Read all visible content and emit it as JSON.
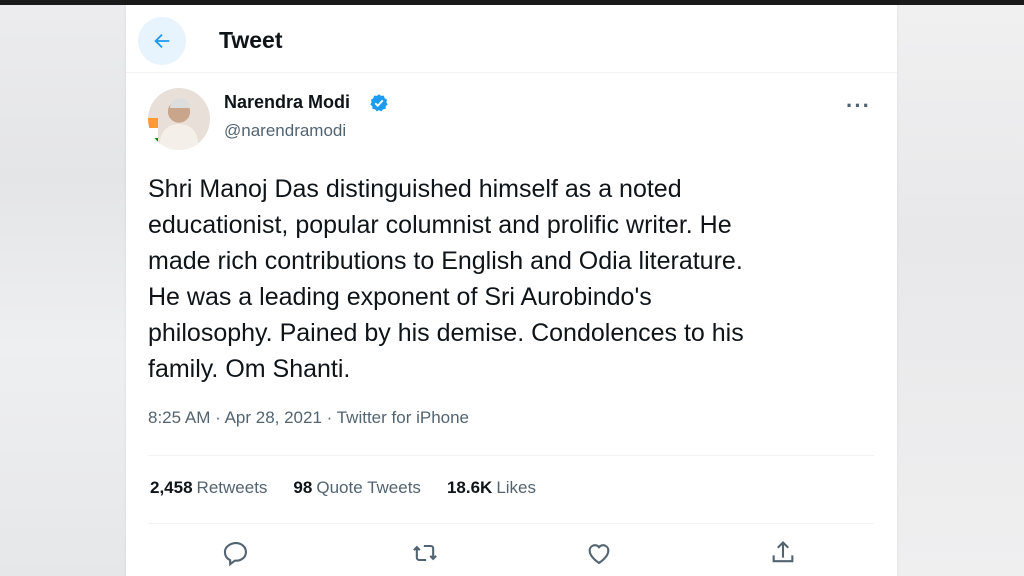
{
  "header": {
    "title": "Tweet"
  },
  "author": {
    "name": "Narendra Modi",
    "handle": "@narendramodi"
  },
  "tweet": {
    "text": "Shri Manoj Das distinguished himself as a noted educationist, popular columnist and prolific writer. He made rich contributions to English and Odia literature. He was a leading exponent of Sri Aurobindo's philosophy. Pained by his demise. Condolences to his family. Om Shanti.",
    "lines": [
      "Shri Manoj Das distinguished himself as a noted",
      "educationist, popular columnist and prolific writer. He",
      "made rich contributions to English and Odia literature.",
      "He was a leading exponent of Sri Aurobindo's",
      "philosophy. Pained by his demise. Condolences to his",
      "family. Om Shanti."
    ],
    "time": "8:25 AM",
    "date": "Apr 28, 2021",
    "source": "Twitter for iPhone"
  },
  "stats": {
    "retweets_count": "2,458",
    "retweets_label": "Retweets",
    "quotes_count": "98",
    "quotes_label": "Quote Tweets",
    "likes_count": "18.6K",
    "likes_label": "Likes"
  },
  "colors": {
    "accent": "#1d9bf0",
    "text": "#0f1419",
    "muted": "#536471"
  },
  "icons": {
    "back": "arrow-left-icon",
    "verified": "verified-badge-icon",
    "more": "more-icon",
    "reply": "reply-icon",
    "retweet": "retweet-icon",
    "like": "heart-icon",
    "share": "share-icon"
  }
}
